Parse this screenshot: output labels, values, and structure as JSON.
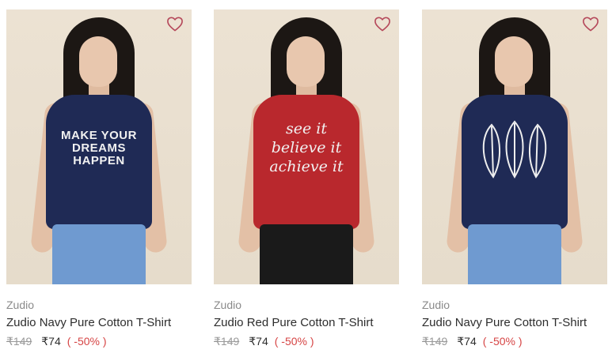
{
  "colors": {
    "wishlist_heart": "#b5485a",
    "discount_text": "#d64545",
    "navy_tee": "#1f2a55",
    "red_tee": "#b9282d",
    "denim": "#6f9ad0",
    "black_pants": "#1a1a1a"
  },
  "products": [
    {
      "brand": "Zudio",
      "title": "Zudio Navy Pure Cotton T-Shirt",
      "mrp": "₹149",
      "price": "₹74",
      "discount": "( -50% )",
      "tee_print": "MAKE YOUR DREAMS HAPPEN",
      "wishlist_icon": "heart-outline-icon"
    },
    {
      "brand": "Zudio",
      "title": "Zudio Red Pure Cotton T-Shirt",
      "mrp": "₹149",
      "price": "₹74",
      "discount": "( -50% )",
      "tee_print": "see it believe it achieve it",
      "wishlist_icon": "heart-outline-icon"
    },
    {
      "brand": "Zudio",
      "title": "Zudio Navy Pure Cotton T-Shirt",
      "mrp": "₹149",
      "price": "₹74",
      "discount": "( -50% )",
      "tee_print": "",
      "wishlist_icon": "heart-outline-icon"
    }
  ]
}
